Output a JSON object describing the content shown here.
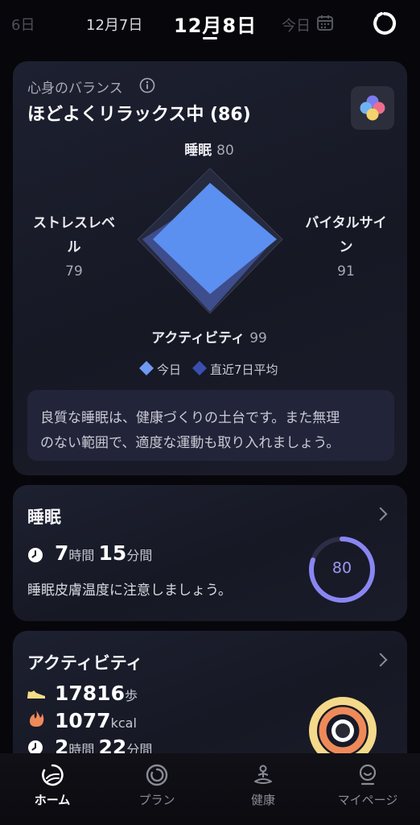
{
  "datebar": {
    "prev_partial": "6日",
    "prev": "12月7日",
    "current": "12月8日",
    "today": "今日"
  },
  "balance": {
    "label": "心身のバランス",
    "info_icon": "info-icon",
    "status": "ほどよくリラックス中 (86)",
    "app_icon": "colorful-petal-icon",
    "axes": {
      "sleep": {
        "label": "睡眠",
        "value": "80"
      },
      "stress": {
        "label_line1": "ストレスレベ",
        "label_line2": "ル",
        "value": "79"
      },
      "vitals": {
        "label_line1": "バイタルサイ",
        "label_line2": "ン",
        "value": "91"
      },
      "activity": {
        "label": "アクティビティ",
        "value": "99"
      }
    },
    "legend_today": "今日",
    "legend_avg": "直近7日平均",
    "message_line1": "良質な睡眠は、健康づくりの土台です。また無理",
    "message_line2": "のない範囲で、適度な運動も取り入れましょう。"
  },
  "sleep_card": {
    "title": "睡眠",
    "hours": "7",
    "hours_unit": "時間",
    "minutes": "15",
    "minutes_unit": "分間",
    "note": "睡眠皮膚温度に注意しましょう。",
    "score": "80",
    "score_fraction": 0.8
  },
  "activity_card": {
    "title": "アクティビティ",
    "steps": "17816",
    "steps_unit": "歩",
    "kcal": "1077",
    "kcal_unit": "kcal",
    "hours": "2",
    "hours_unit": "時間",
    "minutes": "22",
    "minutes_unit": "分間"
  },
  "nav": {
    "home": "ホーム",
    "plan": "プラン",
    "health": "健康",
    "mypage": "マイページ"
  },
  "colors": {
    "today_fill": "#5b8ff0",
    "avg_fill": "#3f4f8f",
    "sleep_ring": "#8a86f2",
    "activity_ring_outer": "#f4d98a",
    "activity_ring_inner": "#ee8a5a"
  }
}
